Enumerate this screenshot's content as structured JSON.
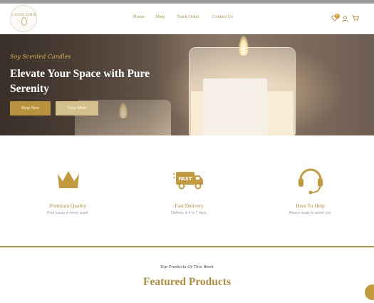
{
  "brand": {
    "logo_text": "CANDLEHUB"
  },
  "nav": {
    "items": [
      {
        "label": "Home"
      },
      {
        "label": "Shop"
      },
      {
        "label": "Track Order"
      },
      {
        "label": "Contact Us"
      }
    ]
  },
  "header_icons": {
    "wishlist_count": "0",
    "wishlist_icon": "heart-icon",
    "user_icon": "user-icon",
    "cart_icon": "cart-icon"
  },
  "hero": {
    "script_text": "Soy Scented Candles",
    "title": "Elevate Your Space with Pure Serenity",
    "primary_button": "Shop Now",
    "secondary_button": "View More"
  },
  "features": [
    {
      "icon": "crown-icon",
      "title": "Premium Quality",
      "subtitle": "Pure luxury in every scent."
    },
    {
      "icon": "delivery-truck-icon",
      "title": "Fast Delivery",
      "subtitle": "Delivery in 4 to 7 days."
    },
    {
      "icon": "headset-icon",
      "title": "Here To Help",
      "subtitle": "Always ready to assist you."
    }
  ],
  "featured": {
    "script_text": "Top Products Of This Week",
    "title": "Featured Products"
  },
  "colors": {
    "accent": "#b8923c",
    "accent_light": "#d3c08a",
    "text_gold": "#b08d3c"
  }
}
